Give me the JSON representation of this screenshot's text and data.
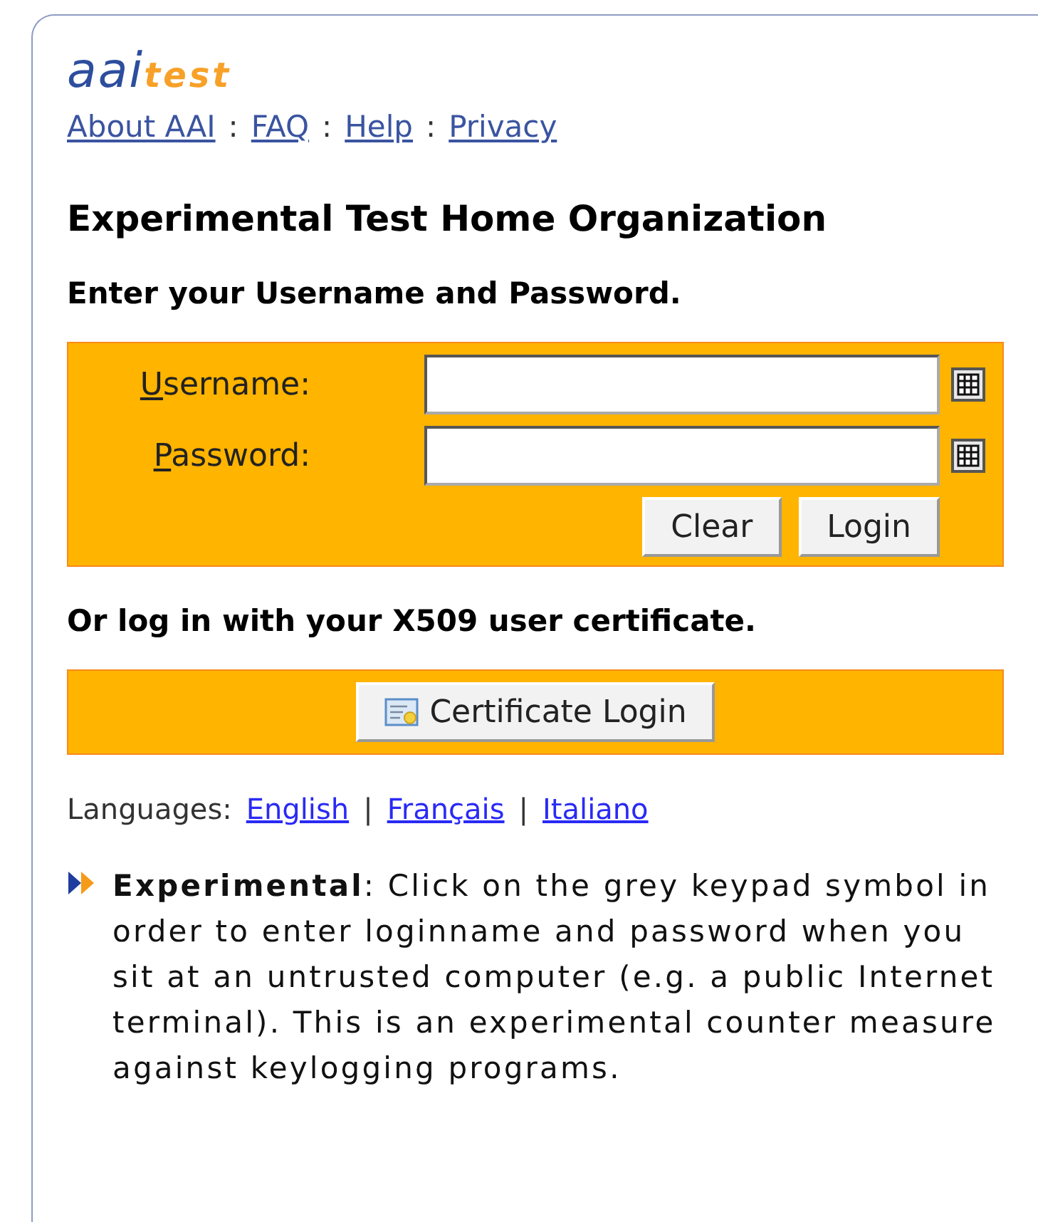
{
  "logo": {
    "main": "aai",
    "sub": "test"
  },
  "nav_links": [
    "About AAI",
    "FAQ",
    "Help",
    "Privacy"
  ],
  "nav_separator": ":",
  "heading": "Experimental Test Home Organization",
  "login_prompt": "Enter your Username and Password.",
  "fields": [
    {
      "label": "Username:"
    },
    {
      "label": "Password:"
    }
  ],
  "buttons": [
    "Clear",
    "Login"
  ],
  "cert_prompt": "Or log in with your X509 user certificate.",
  "cert_button": "Certificate Login",
  "languages": {
    "label": "Languages:",
    "separator": "|",
    "items": [
      "English",
      "Français",
      "Italiano"
    ]
  },
  "note": "**Experimental**: Click on the grey keypad symbol in order to enter loginname and password when you sit at an untrusted computer (e.g. a public Internet terminal). This is an experimental counter measure against keylogging programs."
}
